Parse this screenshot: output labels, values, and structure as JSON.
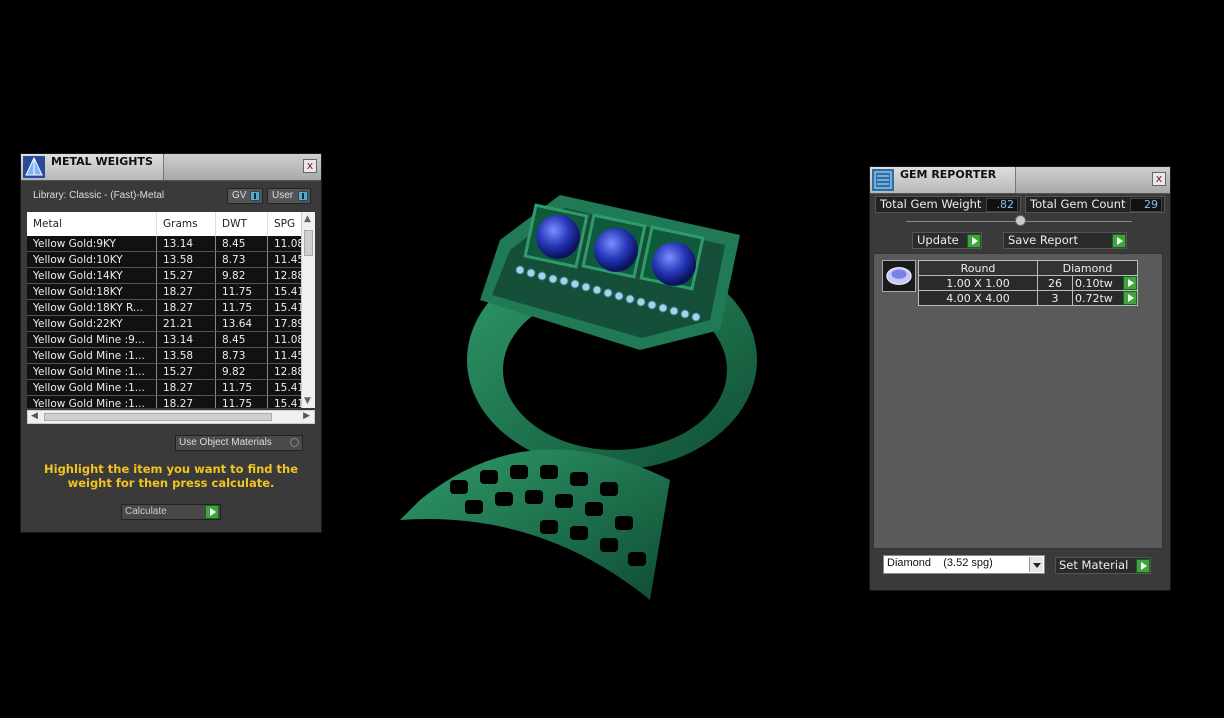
{
  "metal_weights": {
    "title": "METAL WEIGHTS",
    "close": "x",
    "library": "Library: Classic - (Fast)-Metal",
    "toggle_gv": "GV",
    "toggle_user": "User",
    "columns": [
      "Metal",
      "Grams",
      "DWT",
      "SPG"
    ],
    "rows": [
      [
        "Yellow Gold:9KY",
        "13.14",
        "8.45",
        "11.08"
      ],
      [
        "Yellow Gold:10KY",
        "13.58",
        "8.73",
        "11.45"
      ],
      [
        "Yellow Gold:14KY",
        "15.27",
        "9.82",
        "12.88"
      ],
      [
        "Yellow Gold:18KY",
        "18.27",
        "11.75",
        "15.41"
      ],
      [
        "Yellow Gold:18KY R...",
        "18.27",
        "11.75",
        "15.41"
      ],
      [
        "Yellow Gold:22KY",
        "21.21",
        "13.64",
        "17.89"
      ],
      [
        "Yellow Gold Mine :9...",
        "13.14",
        "8.45",
        "11.08"
      ],
      [
        "Yellow Gold Mine :1...",
        "13.58",
        "8.73",
        "11.45"
      ],
      [
        "Yellow Gold Mine :1...",
        "15.27",
        "9.82",
        "12.88"
      ],
      [
        "Yellow Gold Mine :1...",
        "18.27",
        "11.75",
        "15.41"
      ],
      [
        "Yellow Gold Mine :1...",
        "18.27",
        "11.75",
        "15.41"
      ]
    ],
    "use_object_materials": "Use Object Materials",
    "hint": "Highlight the item you want to find the weight for then press calculate.",
    "calculate": "Calculate"
  },
  "gem_reporter": {
    "title": "GEM REPORTER",
    "close": "x",
    "total_gem_weight_label": "Total Gem Weight",
    "total_gem_weight": ".82",
    "total_gem_count_label": "Total Gem Count",
    "total_gem_count": "29",
    "update": "Update",
    "save_report": "Save Report",
    "table_headers": [
      "Round",
      "Diamond"
    ],
    "rows": [
      {
        "size": "1.00 X 1.00",
        "count": "26",
        "weight": "0.10tw"
      },
      {
        "size": "4.00 X 4.00",
        "count": "3",
        "weight": "0.72tw"
      }
    ],
    "material": "Diamond    (3.52 spg)",
    "set_material": "Set Material"
  },
  "colors": {
    "panel_bg": "#3a3a3a",
    "hint_yellow": "#f2c420",
    "value_blue": "#7fc4e8",
    "accent_green": "#3fa33f",
    "ring_green": "#1f7a55",
    "gem_blue": "#2a3fc0"
  }
}
